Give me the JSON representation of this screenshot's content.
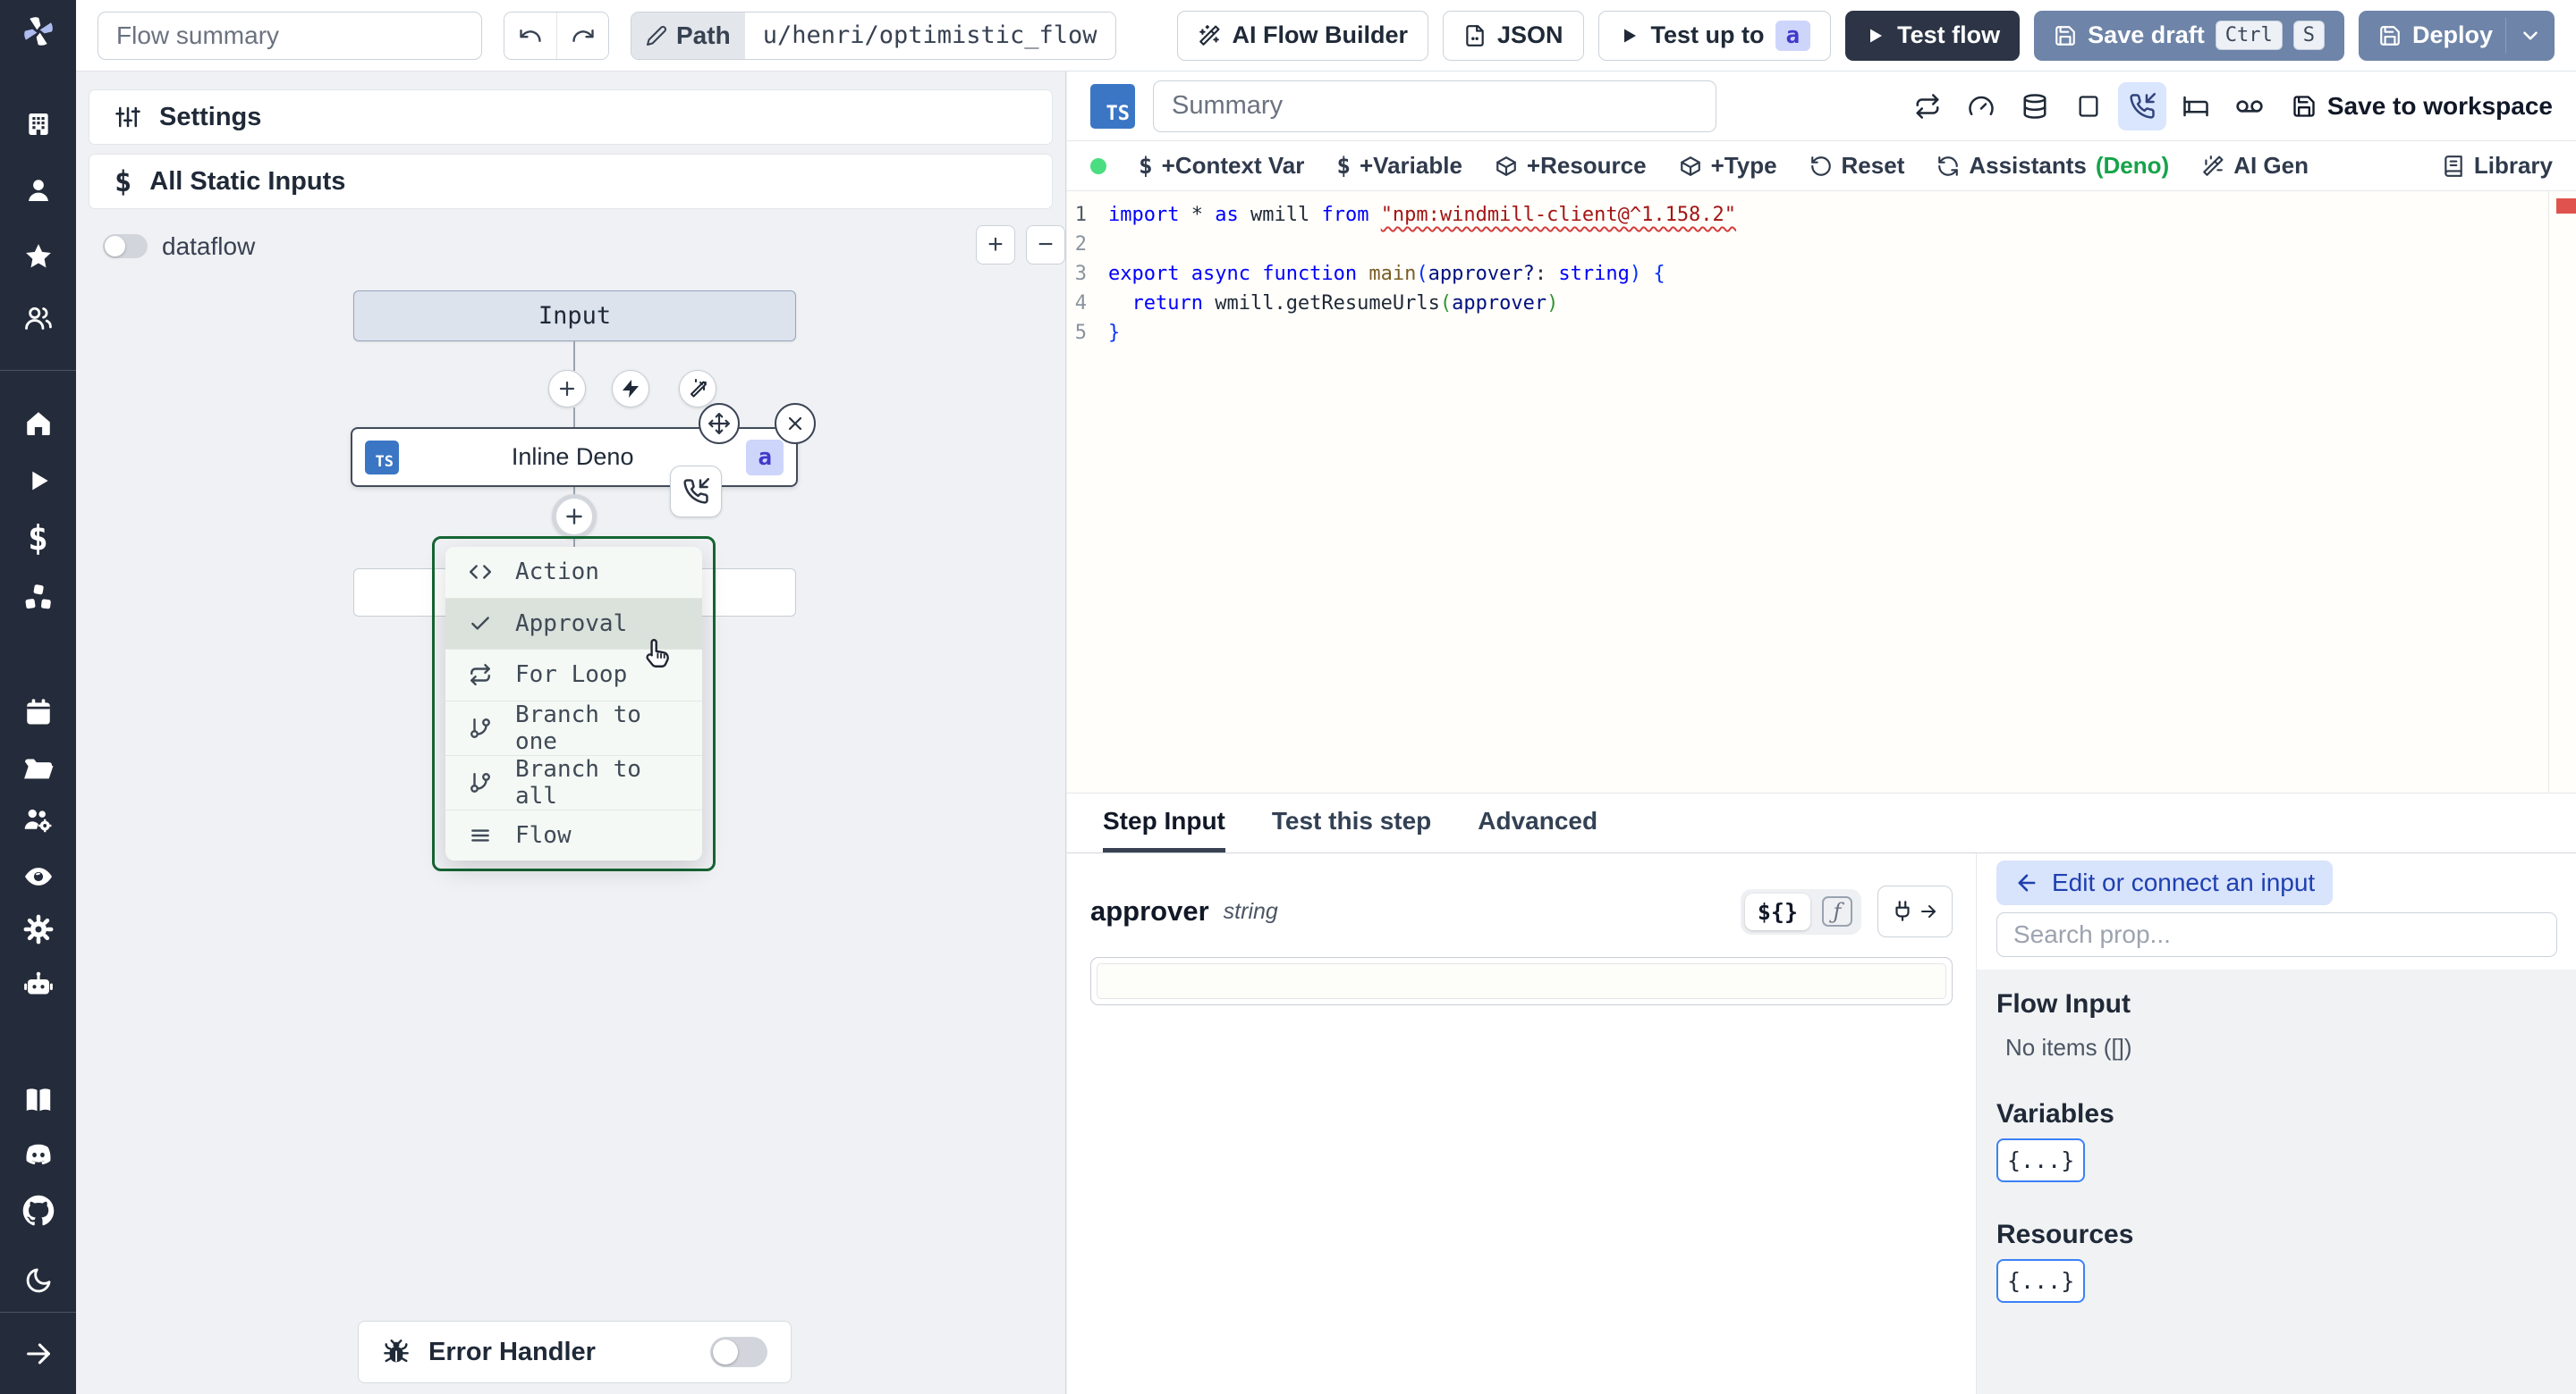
{
  "topbar": {
    "flow_summary_placeholder": "Flow summary",
    "path_label": "Path",
    "path_value": "u/henri/optimistic_flow",
    "ai_flow_builder_label": "AI Flow Builder",
    "json_label": "JSON",
    "test_up_to_label": "Test up to",
    "test_up_to_badge": "a",
    "test_flow_label": "Test flow",
    "save_draft_label": "Save draft",
    "kbd_ctrl": "Ctrl",
    "kbd_s": "S",
    "deploy_label": "Deploy"
  },
  "flow_panel": {
    "settings_label": "Settings",
    "static_inputs_label": "All Static Inputs",
    "dataflow_label": "dataflow",
    "zoom_in": "+",
    "zoom_out": "−",
    "input_node_label": "Input",
    "step_node": {
      "lang_badge": "TS",
      "label": "Inline Deno",
      "id_badge": "a"
    },
    "insert_menu": {
      "items": [
        {
          "label": "Action"
        },
        {
          "label": "Approval"
        },
        {
          "label": "For Loop"
        },
        {
          "label": "Branch to one"
        },
        {
          "label": "Branch to all"
        },
        {
          "label": "Flow"
        }
      ]
    },
    "error_handler_label": "Error Handler"
  },
  "editor": {
    "lang_badge": "TS",
    "summary_placeholder": "Summary",
    "save_to_workspace_label": "Save to workspace",
    "toolbar": {
      "context_var": "+Context Var",
      "variable": "+Variable",
      "resource": "+Resource",
      "type": "+Type",
      "reset": "Reset",
      "assistants": "Assistants",
      "assistants_suffix": "(Deno)",
      "ai_gen": "AI Gen",
      "library": "Library"
    },
    "code_lines": [
      {
        "n": "1",
        "active": true,
        "segs": [
          {
            "t": "import ",
            "c": "kw"
          },
          {
            "t": "* ",
            "c": "ct"
          },
          {
            "t": "as ",
            "c": "kw"
          },
          {
            "t": "wmill ",
            "c": "ct"
          },
          {
            "t": "from ",
            "c": "kw"
          },
          {
            "t": "\"npm:windmill-client@^1.158.2\"",
            "c": "str err"
          }
        ]
      },
      {
        "n": "2",
        "segs": []
      },
      {
        "n": "3",
        "segs": [
          {
            "t": "export ",
            "c": "kw"
          },
          {
            "t": "async ",
            "c": "kw"
          },
          {
            "t": "function ",
            "c": "kw"
          },
          {
            "t": "main",
            "c": "fn"
          },
          {
            "t": "(",
            "c": "b1"
          },
          {
            "t": "approver?",
            "c": "pl"
          },
          {
            "t": ": ",
            "c": "ct"
          },
          {
            "t": "string",
            "c": "kw"
          },
          {
            "t": ") ",
            "c": "b1"
          },
          {
            "t": "{",
            "c": "b1"
          }
        ]
      },
      {
        "n": "4",
        "segs": [
          {
            "t": "  ",
            "c": "ct"
          },
          {
            "t": "return ",
            "c": "kw"
          },
          {
            "t": "wmill.getResumeUrls",
            "c": "ct"
          },
          {
            "t": "(",
            "c": "b2"
          },
          {
            "t": "approver",
            "c": "pl"
          },
          {
            "t": ")",
            "c": "b2"
          }
        ]
      },
      {
        "n": "5",
        "segs": [
          {
            "t": "}",
            "c": "b1"
          }
        ]
      }
    ]
  },
  "step_panel": {
    "tabs": [
      {
        "label": "Step Input"
      },
      {
        "label": "Test this step"
      },
      {
        "label": "Advanced"
      }
    ],
    "field": {
      "name": "approver",
      "type": "string"
    },
    "expr_badge": "${}",
    "fn_badge": "ƒ",
    "prop_picker": {
      "back_label": "Edit or connect an input",
      "search_placeholder": "Search prop...",
      "flow_input_label": "Flow Input",
      "no_items_label": "No items ([])",
      "variables_label": "Variables",
      "resources_label": "Resources",
      "object_chip": "{...}"
    }
  },
  "colors": {
    "sidebar_bg": "#242b3a",
    "slate_button": "#6e84a8",
    "dark_button": "#2c3446",
    "ts_badge": "#3b76c5",
    "id_badge_bg": "#cdd5fb",
    "id_badge_text": "#4338ca",
    "menu_border_green": "#166534",
    "status_green": "#4ade80",
    "deno_green": "#16a34a",
    "error_marker_red": "#e0524d"
  }
}
